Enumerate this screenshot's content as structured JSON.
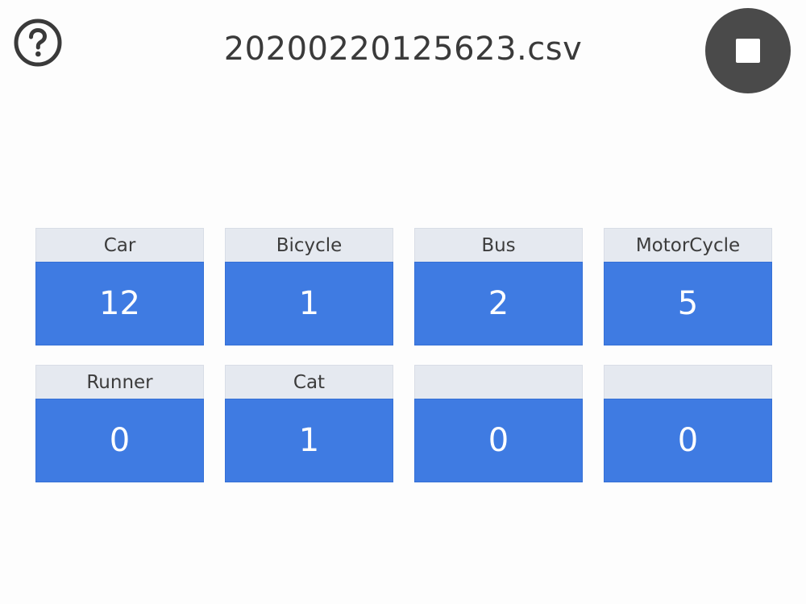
{
  "header": {
    "title": "20200220125623.csv",
    "help_icon": "question-circle-icon",
    "stop_icon": "stop-icon"
  },
  "colors": {
    "tile_label_bg": "#e5e9f0",
    "tile_count_bg": "#3f7be2",
    "stop_button_bg": "#4a4a4a"
  },
  "counters": [
    {
      "label": "Car",
      "count": "12"
    },
    {
      "label": "Bicycle",
      "count": "1"
    },
    {
      "label": "Bus",
      "count": "2"
    },
    {
      "label": "MotorCycle",
      "count": "5"
    },
    {
      "label": "Runner",
      "count": "0"
    },
    {
      "label": "Cat",
      "count": "1"
    },
    {
      "label": "",
      "count": "0"
    },
    {
      "label": "",
      "count": "0"
    }
  ]
}
